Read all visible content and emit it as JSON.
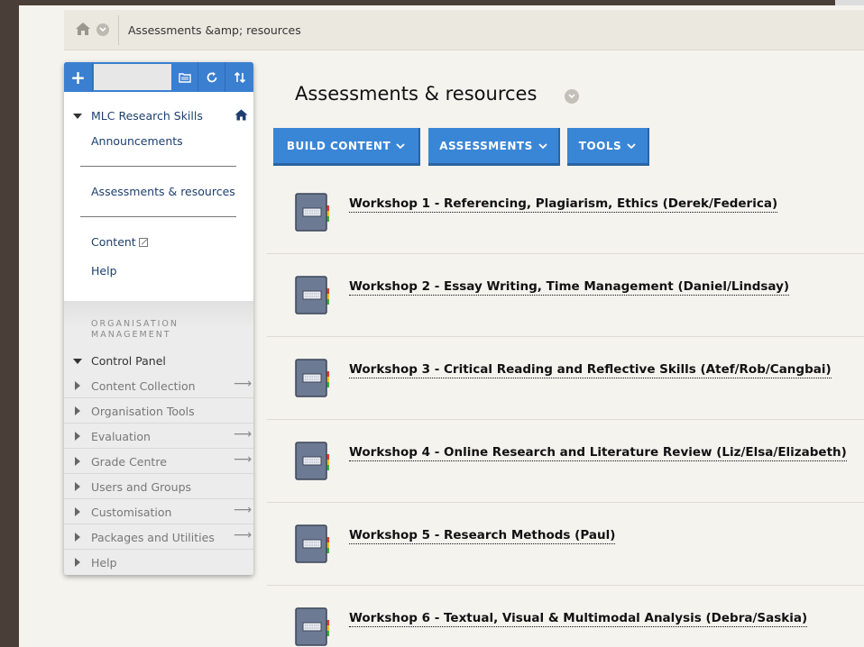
{
  "breadcrumb": {
    "current": "Assessments &amp; resources",
    "home_icon": "home-icon"
  },
  "course_menu": {
    "course_name": "MLC Research Skills",
    "links": [
      "Announcements",
      "Assessments & resources",
      "Content",
      "Help"
    ]
  },
  "management": {
    "heading_line1": "ORGANISATION",
    "heading_line2": "MANAGEMENT",
    "control_panel": "Control Panel",
    "items": [
      {
        "label": "Content Collection"
      },
      {
        "label": "Organisation Tools"
      },
      {
        "label": "Evaluation"
      },
      {
        "label": "Grade Centre"
      },
      {
        "label": "Users and Groups"
      },
      {
        "label": "Customisation"
      },
      {
        "label": "Packages and Utilities"
      },
      {
        "label": "Help"
      }
    ]
  },
  "page": {
    "title": "Assessments & resources",
    "buttons": [
      "BUILD CONTENT",
      "ASSESSMENTS",
      "TOOLS"
    ]
  },
  "items": [
    "Workshop 1 - Referencing, Plagiarism, Ethics (Derek/Federica)",
    "Workshop 2 - Essay Writing, Time Management (Daniel/Lindsay)",
    "Workshop 3 - Critical Reading and Reflective Skills (Atef/Rob/Cangbai)",
    "Workshop 4 - Online Research and Literature Review (Liz/Elsa/Elizabeth)",
    "Workshop 5 - Research Methods (Paul)",
    "Workshop 6 - Textual, Visual & Multimodal Analysis (Debra/Saskia)"
  ],
  "colors": {
    "accent": "#3a86d6",
    "nav_text": "#1d3f6e"
  }
}
